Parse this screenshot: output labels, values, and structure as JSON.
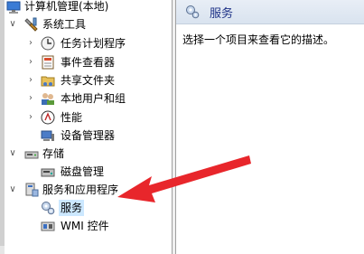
{
  "tree": {
    "root": {
      "label": "计算机管理(本地)"
    },
    "system_tools": {
      "label": "系统工具"
    },
    "task_scheduler": {
      "label": "任务计划程序"
    },
    "event_viewer": {
      "label": "事件查看器"
    },
    "shared_folders": {
      "label": "共享文件夹"
    },
    "local_users": {
      "label": "本地用户和组"
    },
    "performance": {
      "label": "性能"
    },
    "device_manager": {
      "label": "设备管理器"
    },
    "storage": {
      "label": "存储"
    },
    "disk_management": {
      "label": "磁盘管理"
    },
    "services_apps": {
      "label": "服务和应用程序"
    },
    "services": {
      "label": "服务"
    },
    "wmi_control": {
      "label": "WMI 控件"
    }
  },
  "right_pane": {
    "title": "服务",
    "description": "选择一个项目来查看它的描述。"
  },
  "colors": {
    "arrow": "#e8262b",
    "selection": "#cce8ff",
    "header_text": "#1e3287"
  }
}
